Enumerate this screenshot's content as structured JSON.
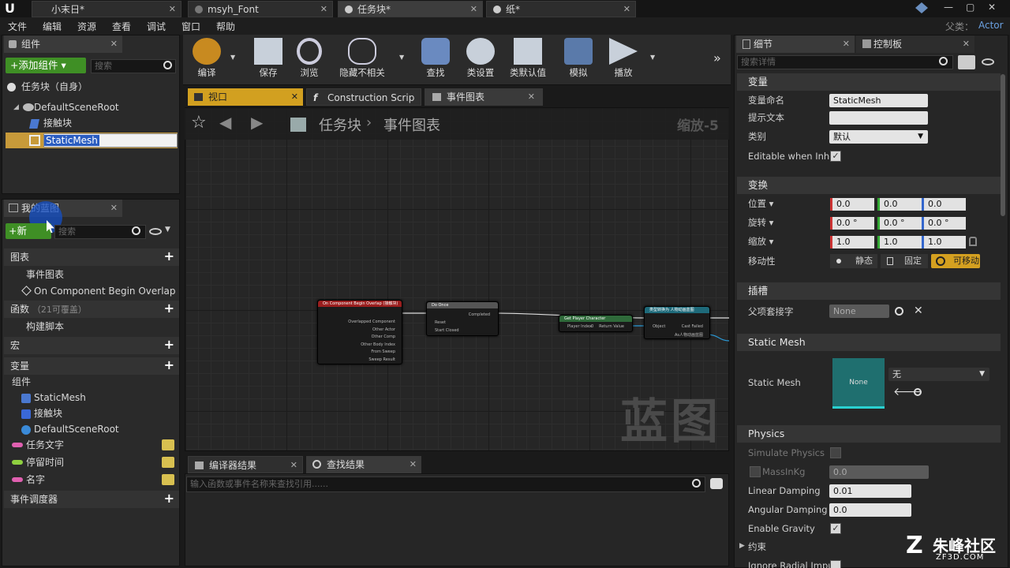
{
  "doc_tabs": [
    "小末日*",
    "msyh_Font",
    "任务块*",
    "纸*"
  ],
  "parent_class": {
    "label": "父类：",
    "value": "Actor"
  },
  "menu": [
    "文件",
    "编辑",
    "资源",
    "查看",
    "调试",
    "窗口",
    "帮助"
  ],
  "components_panel": {
    "title": "组件",
    "add_button": "+添加组件 ▾",
    "search_placeholder": "搜索",
    "self_item": "任务块（自身）",
    "tree": [
      "DefaultSceneRoot",
      "接触块",
      "StaticMesh"
    ]
  },
  "my_blueprint": {
    "title": "我的蓝图",
    "new_button": "新",
    "search_placeholder": "搜索",
    "sections": {
      "graphs": "图表",
      "event_graph": "事件图表",
      "event_item": "On Component Begin Overlap (",
      "functions": "函数",
      "functions_note": "（21可覆盖）",
      "construct": "构建脚本",
      "macros": "宏",
      "variables": "变量",
      "components": "组件",
      "comp_items": [
        "StaticMesh",
        "接触块",
        "DefaultSceneRoot"
      ],
      "vars": [
        {
          "name": "任务文字",
          "color": "#e060b0"
        },
        {
          "name": "停留时间",
          "color": "#8fd040"
        },
        {
          "name": "名字",
          "color": "#e060b0"
        }
      ],
      "dispatchers": "事件调度器"
    }
  },
  "toolbar": [
    "编译",
    "保存",
    "浏览",
    "隐藏不相关",
    "查找",
    "类设置",
    "类默认值",
    "模拟",
    "播放"
  ],
  "editor_tabs": [
    "视口",
    "Construction Scrip",
    "事件图表"
  ],
  "breadcrumb": {
    "root": "任务块",
    "sep": "›",
    "current": "事件图表",
    "zoom": "缩放-5"
  },
  "watermark": "蓝图",
  "nodes": {
    "event": {
      "title": "On Component Begin Overlap (接触块)",
      "pins": [
        "Overlapped Component",
        "Other Actor",
        "Other Comp",
        "Other Body Index",
        "From Sweep",
        "Sweep Result"
      ]
    },
    "doonce": {
      "title": "Do Once",
      "pins": [
        "Reset",
        "Start Closed",
        "Completed"
      ]
    },
    "getplayer": {
      "title": "Get Player Character",
      "pins": [
        "Player Index",
        "0",
        "Return Value"
      ]
    },
    "cast": {
      "title": "类型转换为 人物动画蓝图",
      "pins": [
        "Object",
        "Cast Failed",
        "As人物动画蓝图"
      ]
    }
  },
  "bottom_tabs": [
    "编译器结果",
    "查找结果"
  ],
  "find_placeholder": "输入函数或事件名称来查找引用......",
  "details": {
    "tabs": [
      "细节",
      "控制板"
    ],
    "search_placeholder": "搜索详情",
    "variable_section": "变量",
    "var_name_label": "变量命名",
    "var_name_value": "StaticMesh",
    "tooltip_label": "提示文本",
    "category_label": "类别",
    "category_value": "默认",
    "editable_label": "Editable when Inheri",
    "transform_section": "变换",
    "location_label": "位置 ▾",
    "rotation_label": "旋转 ▾",
    "scale_label": "缩放 ▾",
    "location": [
      "0.0",
      "0.0",
      "0.0"
    ],
    "rotation": [
      "0.0 °",
      "0.0 °",
      "0.0 °"
    ],
    "scale": [
      "1.0",
      "1.0",
      "1.0"
    ],
    "mobility_label": "移动性",
    "mobility_options": [
      "静态",
      "固定",
      "可移动"
    ],
    "socket_section": "插槽",
    "parent_socket_label": "父项套接字",
    "parent_socket_value": "None",
    "static_mesh_section": "Static Mesh",
    "static_mesh_label": "Static Mesh",
    "thumbnail_label": "None",
    "mesh_value": "无",
    "physics_section": "Physics",
    "simulate_label": "Simulate Physics",
    "mass_label": "MassInKg",
    "mass_value": "0.0",
    "linear_label": "Linear Damping",
    "linear_value": "0.01",
    "angular_label": "Angular Damping",
    "angular_value": "0.0",
    "gravity_label": "Enable Gravity",
    "constraints_label": "约束",
    "radial_label": "Ignore Radial Impuls"
  },
  "brand": {
    "name": "朱峰社区",
    "url": "ZF3D.COM"
  }
}
